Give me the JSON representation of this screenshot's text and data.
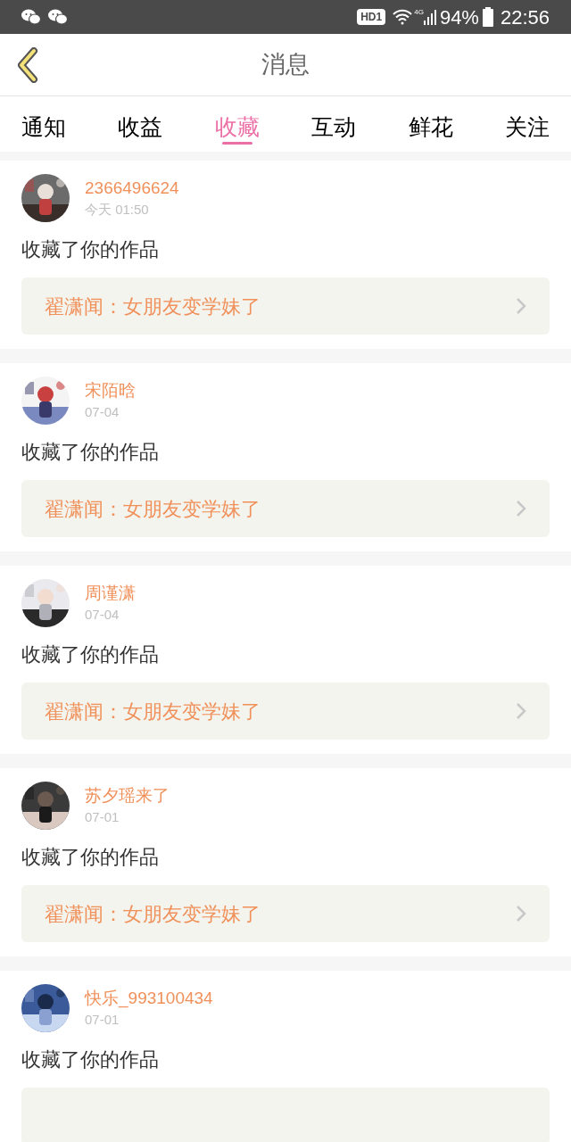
{
  "status_bar": {
    "hd_badge": "HD1",
    "network": "4G",
    "battery": "94%",
    "time": "22:56"
  },
  "header": {
    "title": "消息"
  },
  "tabs": [
    {
      "label": "通知",
      "selected": false
    },
    {
      "label": "收益",
      "selected": false
    },
    {
      "label": "收藏",
      "selected": true
    },
    {
      "label": "互动",
      "selected": false
    },
    {
      "label": "鲜花",
      "selected": false
    },
    {
      "label": "关注",
      "selected": false
    }
  ],
  "messages": [
    {
      "user": "2366496624",
      "time": "今天 01:50",
      "text": "收藏了你的作品",
      "work": "翟潇闻：女朋友变学妹了"
    },
    {
      "user": "宋陌晗",
      "time": "07-04",
      "text": "收藏了你的作品",
      "work": "翟潇闻：女朋友变学妹了"
    },
    {
      "user": "周谨潇",
      "time": "07-04",
      "text": "收藏了你的作品",
      "work": "翟潇闻：女朋友变学妹了"
    },
    {
      "user": "苏夕瑶来了",
      "time": "07-01",
      "text": "收藏了你的作品",
      "work": "翟潇闻：女朋友变学妹了"
    },
    {
      "user": "快乐_993100434",
      "time": "07-01",
      "text": "收藏了你的作品"
    }
  ]
}
